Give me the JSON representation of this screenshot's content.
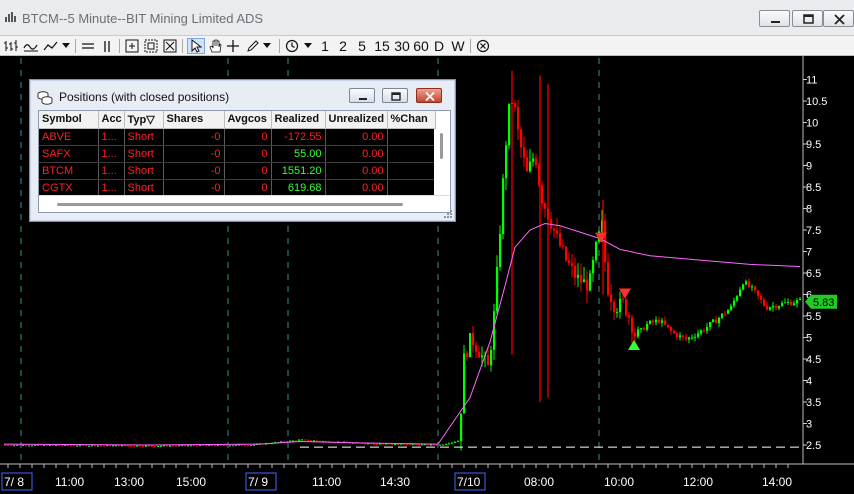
{
  "window": {
    "title": "BTCM--5 Minute--BIT Mining Limited ADS"
  },
  "toolbar": {
    "intervals": [
      "1",
      "2",
      "5",
      "15",
      "30",
      "60",
      "D",
      "W"
    ]
  },
  "chart": {
    "price_ticks": [
      "11",
      "10.5",
      "10",
      "9.5",
      "9",
      "8.5",
      "8",
      "7.5",
      "7",
      "6.5",
      "6",
      "5.5",
      "5",
      "4.5",
      "4",
      "3.5",
      "3",
      "2.5"
    ],
    "current_price": "5.83",
    "time_labels": [
      "7/ 8",
      "11:00",
      "13:00",
      "15:00",
      "7/ 9",
      "11:00",
      "14:30",
      "7/10",
      "08:00",
      "10:00",
      "12:00",
      "14:00"
    ],
    "colors": {
      "up": "#00ff00",
      "down": "#ff0000",
      "ma": "#ff66ff",
      "grid": "#3a8f8f",
      "price_tag": "#22cc22"
    }
  },
  "positions": {
    "title": "Positions (with closed positions)",
    "columns": [
      "Symbol",
      "Acc",
      "Typ▽",
      "Shares",
      "Avgcos",
      "Realized",
      "Unrealized",
      "%Chan"
    ],
    "rows": [
      {
        "symbol": "ABVE",
        "acct": "1...",
        "type": "Short",
        "shares": "-0",
        "avgcost": "0",
        "realized": "-172.55",
        "unrealized": "0.00",
        "pct": ""
      },
      {
        "symbol": "SAFX",
        "acct": "1...",
        "type": "Short",
        "shares": "-0",
        "avgcost": "0",
        "realized": "55.00",
        "unrealized": "0.00",
        "pct": ""
      },
      {
        "symbol": "BTCM",
        "acct": "1...",
        "type": "Short",
        "shares": "-0",
        "avgcost": "0",
        "realized": "1551.20",
        "unrealized": "0.00",
        "pct": ""
      },
      {
        "symbol": "CGTX",
        "acct": "1...",
        "type": "Short",
        "shares": "-0",
        "avgcost": "0",
        "realized": "619.68",
        "unrealized": "0.00",
        "pct": ""
      }
    ]
  },
  "icons": [
    "chart-icon",
    "minimize-icon",
    "restore-icon",
    "close-icon",
    "cursor-icon",
    "hand-icon",
    "crosshair-icon",
    "pencil-icon",
    "clock-icon",
    "cancel-icon"
  ]
}
